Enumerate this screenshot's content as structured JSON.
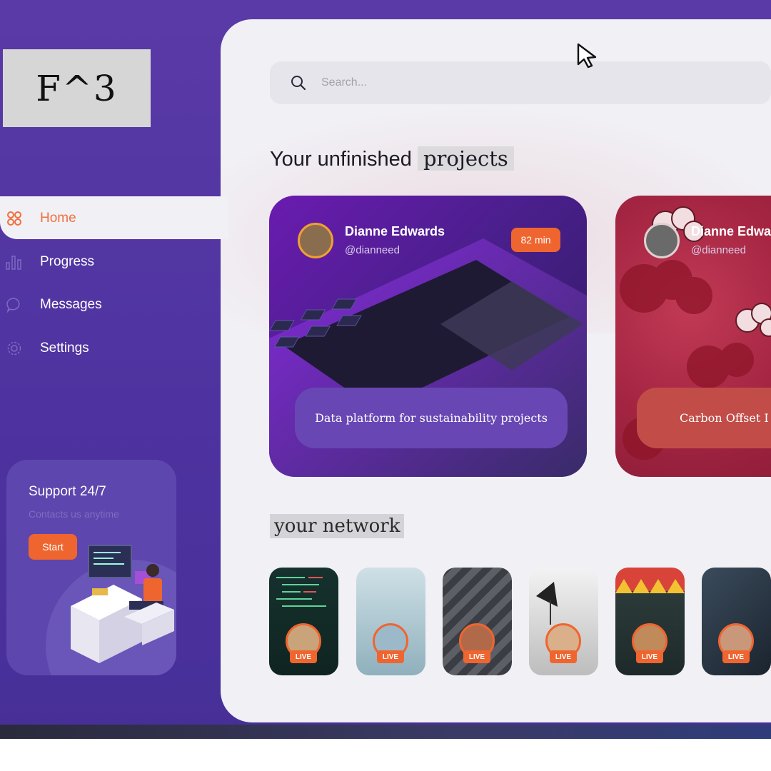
{
  "logo": {
    "text": "F^3"
  },
  "nav": {
    "items": [
      {
        "label": "Home",
        "active": true,
        "icon": "grid-icon"
      },
      {
        "label": "Progress",
        "active": false,
        "icon": "bar-chart-icon"
      },
      {
        "label": "Messages",
        "active": false,
        "icon": "chat-bubble-icon"
      },
      {
        "label": "Settings",
        "active": false,
        "icon": "gear-icon"
      }
    ]
  },
  "support": {
    "title": "Support 24/7",
    "subtitle": "Contacts us anytime",
    "button_label": "Start"
  },
  "search": {
    "placeholder": "Search..."
  },
  "projects": {
    "title_prefix": "Your unfinished",
    "title_highlight": "projects",
    "cards": [
      {
        "user": "Dianne Edwards",
        "handle": "@dianneed",
        "duration": "82 min",
        "caption": "Data platform for sustainability projects"
      },
      {
        "user": "Dianne Edwards",
        "handle": "@dianneed",
        "caption": "Carbon Offset I"
      }
    ]
  },
  "network": {
    "title": "your network",
    "live_label": "LIVE"
  },
  "colors": {
    "accent": "#ef6530",
    "sidebar": "#5a3aa6",
    "panel": "#f1f0f5"
  }
}
